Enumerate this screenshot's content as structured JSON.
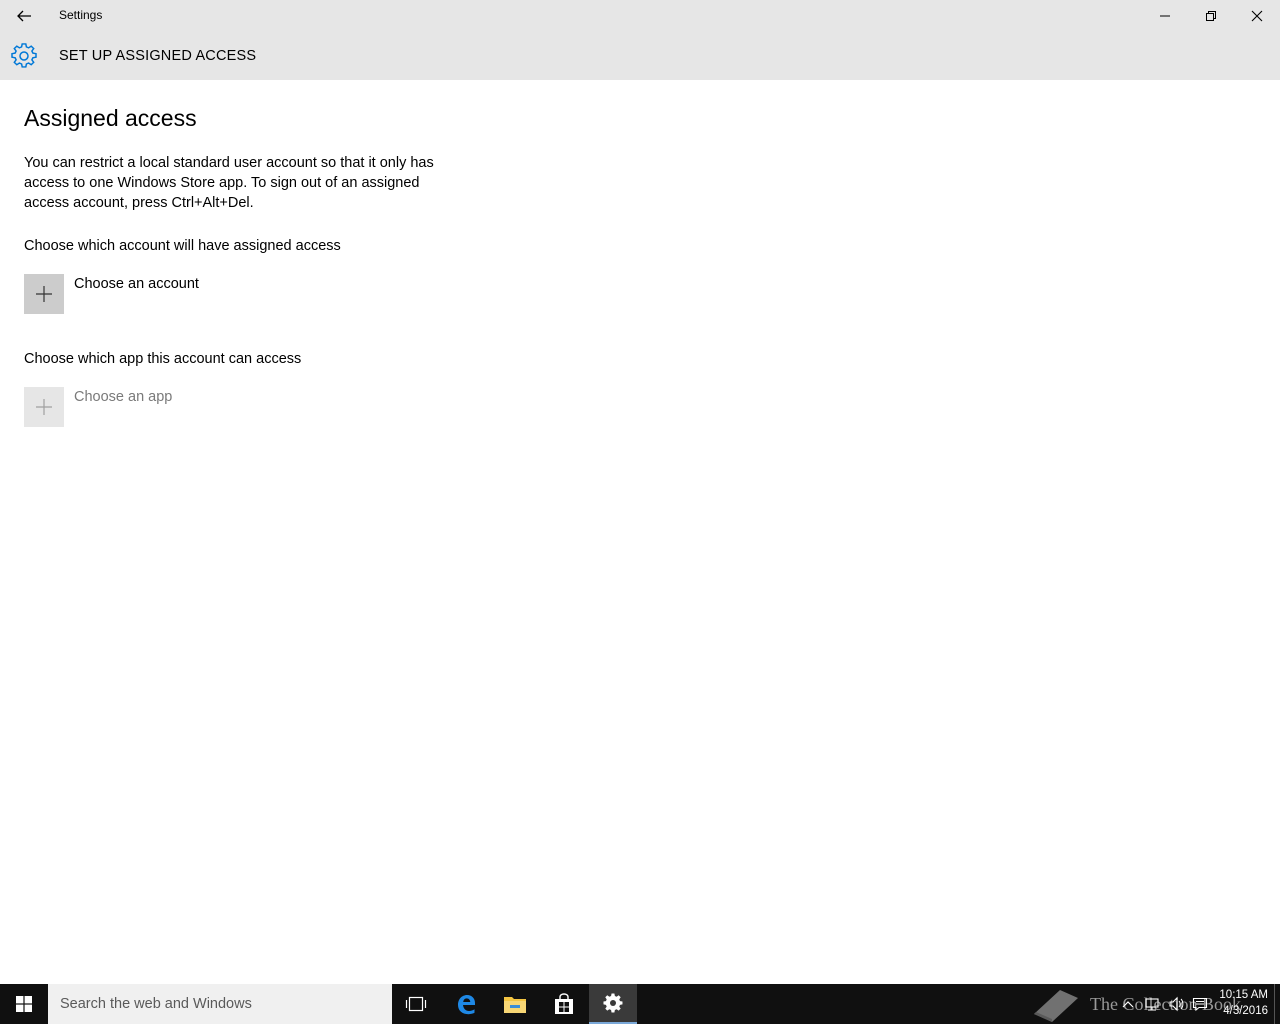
{
  "window": {
    "title": "Settings"
  },
  "header": {
    "title": "SET UP ASSIGNED ACCESS",
    "icon": "gear-icon",
    "accent_color": "#0078d7"
  },
  "main": {
    "heading": "Assigned access",
    "description": "You can restrict a local standard user account so that it only has access to one Windows Store app. To sign out of an assigned access account, press Ctrl+Alt+Del.",
    "account_section": {
      "label": "Choose which account will have assigned access",
      "button_label": "Choose an account",
      "enabled": true
    },
    "app_section": {
      "label": "Choose which app this account can access",
      "button_label": "Choose an app",
      "enabled": false
    }
  },
  "taskbar": {
    "search_placeholder": "Search the web and Windows",
    "pinned": [
      "task-view-icon",
      "edge-icon",
      "file-explorer-icon",
      "store-icon",
      "settings-icon"
    ],
    "active": "settings-icon",
    "watermark_text": "The Collection Book",
    "clock": {
      "time": "10:15 AM",
      "date": "4/3/2016"
    }
  }
}
